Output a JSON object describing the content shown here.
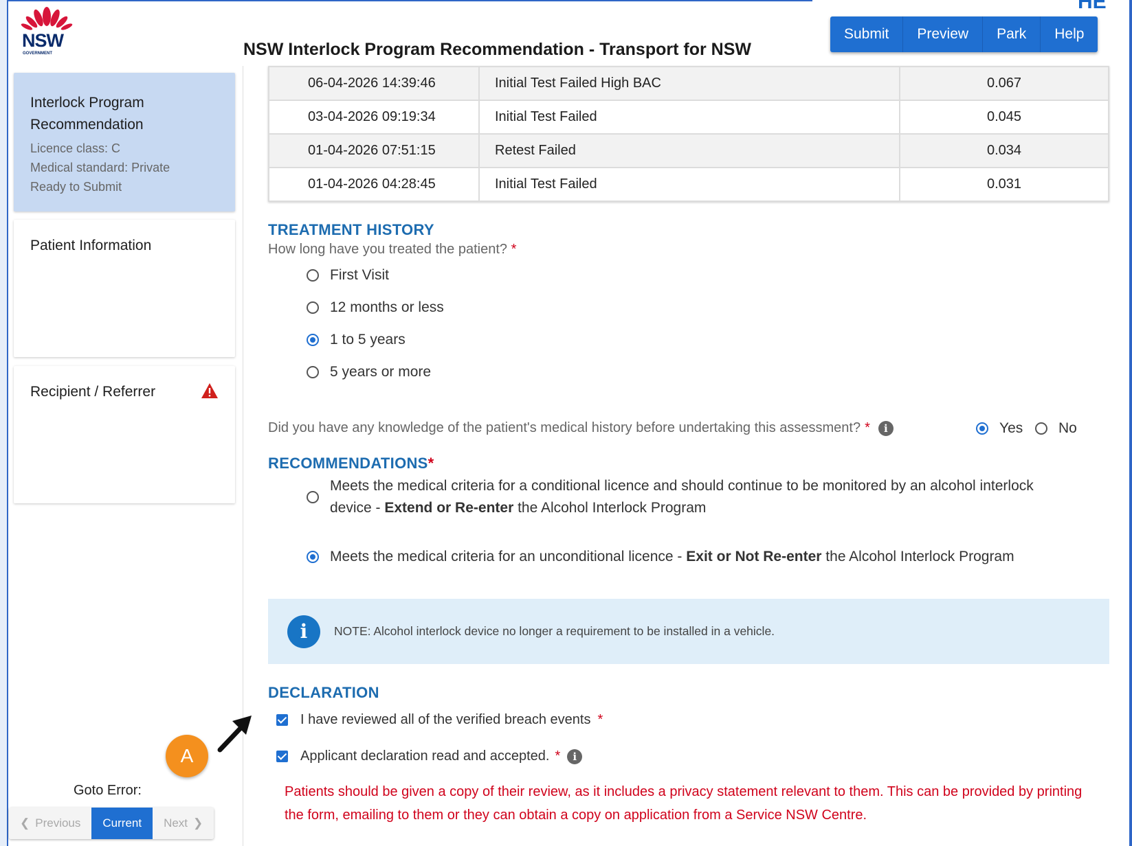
{
  "header": {
    "logo_name": "NSW",
    "logo_sub": "GOVERNMENT",
    "title": "NSW Interlock Program Recommendation - Transport for NSW",
    "corner_glyph": "HE"
  },
  "toolbar": {
    "submit_label": "Submit",
    "preview_label": "Preview",
    "park_label": "Park",
    "help_label": "Help"
  },
  "sidebar": {
    "recommendation": {
      "title_line1": "Interlock Program",
      "title_line2": "Recommendation",
      "licence_class": "Licence class: C",
      "medical_standard": "Medical standard: Private",
      "status": "Ready to Submit"
    },
    "patient_info": {
      "title": "Patient Information"
    },
    "recipient": {
      "title": "Recipient / Referrer",
      "warning_icon": "warning-triangle-icon"
    },
    "goto_error": {
      "label": "Goto Error:",
      "previous": "Previous",
      "current": "Current",
      "next": "Next"
    }
  },
  "breach_table": {
    "rows": [
      [
        "06-04-2026 14:39:46",
        "Initial Test Failed High BAC",
        "0.067"
      ],
      [
        "03-04-2026 09:19:34",
        "Initial Test Failed",
        "0.045"
      ],
      [
        "01-04-2026 07:51:15",
        "Retest Failed",
        "0.034"
      ],
      [
        "01-04-2026 04:28:45",
        "Initial Test Failed",
        "0.031"
      ]
    ]
  },
  "treatment": {
    "heading": "TREATMENT HISTORY",
    "question": "How long have you treated the patient?",
    "required_mark": "*",
    "options": [
      "First Visit",
      "12 months or less",
      "1 to 5 years",
      "5 years or more"
    ],
    "selected": "1 to 5 years"
  },
  "knowledge": {
    "question": "Did you have any knowledge of the patient's medical history before undertaking this assessment?",
    "required_mark": "*",
    "yes_label": "Yes",
    "no_label": "No",
    "selected": "Yes"
  },
  "recommendations": {
    "heading": "RECOMMENDATIONS",
    "required_mark": "*",
    "option1": {
      "line1": "Meets the medical criteria for a conditional licence and should continue to be monitored by an alcohol interlock",
      "prefix": "device - ",
      "bold": "Extend or Re-enter",
      "suffix": " the Alcohol Interlock Program"
    },
    "option2": {
      "prefix": "Meets the medical criteria for an unconditional licence - ",
      "bold": "Exit or Not Re-enter",
      "suffix": " the Alcohol Interlock Program"
    },
    "selected": "option2"
  },
  "note": {
    "text": "NOTE: Alcohol interlock device no longer a requirement to be installed in a vehicle."
  },
  "declaration": {
    "heading": "DECLARATION",
    "check1": "I have reviewed all of the verified breach events",
    "check2": "Applicant declaration read and accepted.",
    "required_mark": "*",
    "privacy": "Patients should be given a copy of their review, as it includes a privacy statement relevant to them. This can be provided by printing the form, emailing to them or they can obtain a copy on application from a Service NSW Centre."
  },
  "annotation": {
    "badge": "A"
  },
  "colors": {
    "accent": "#1f6fd1",
    "heading_blue": "#1d6cb0",
    "error_red": "#d0021b",
    "annotation_orange": "#f4901e",
    "sidebar_active": "#c7d9f2"
  }
}
